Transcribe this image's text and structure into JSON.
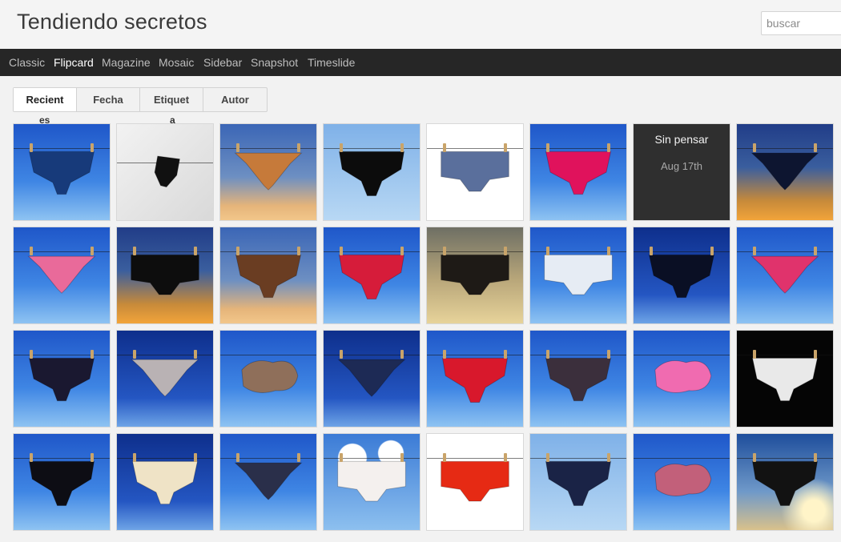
{
  "site": {
    "title": "Tendiendo secretos"
  },
  "search": {
    "placeholder": "buscar"
  },
  "nav": {
    "items": [
      {
        "label": "Classic",
        "active": false
      },
      {
        "label": "Flipcard",
        "active": true
      },
      {
        "label": "Magazine",
        "active": false
      },
      {
        "label": "Mosaic",
        "active": false
      },
      {
        "label": "Sidebar",
        "active": false
      },
      {
        "label": "Snapshot",
        "active": false
      },
      {
        "label": "Timeslide",
        "active": false
      }
    ]
  },
  "tabs": {
    "items": [
      {
        "label": "Recient",
        "active": true
      },
      {
        "label": "Fecha",
        "active": false
      },
      {
        "label": "Etiquet",
        "active": false
      },
      {
        "label": "Autor",
        "active": false
      }
    ],
    "overflow": [
      "es",
      "a"
    ]
  },
  "grid": {
    "cards": [
      {
        "type": "photo",
        "sky": "sky-blue",
        "color": "#173a7a",
        "shape": "brief"
      },
      {
        "type": "photo",
        "sky": "sky-gray",
        "color": "#111111",
        "shape": "shadow"
      },
      {
        "type": "photo",
        "sky": "sky-dusk",
        "color": "#c67a3a",
        "shape": "thong"
      },
      {
        "type": "photo",
        "sky": "sky-pale",
        "color": "#0c0c0c",
        "shape": "lace"
      },
      {
        "type": "photo",
        "sky": "sky-white",
        "color": "#5a6f9c",
        "shape": "hipster"
      },
      {
        "type": "photo",
        "sky": "sky-blue",
        "color": "#e0125c",
        "shape": "brief"
      },
      {
        "type": "text",
        "title": "Sin pensar",
        "date": "Aug 17th"
      },
      {
        "type": "photo",
        "sky": "sky-sunset",
        "color": "#0d1530",
        "shape": "thong"
      },
      {
        "type": "photo",
        "sky": "sky-blue",
        "color": "#e96a9a",
        "shape": "thong"
      },
      {
        "type": "photo",
        "sky": "sky-sunset",
        "color": "#0d0d0d",
        "shape": "hipster"
      },
      {
        "type": "photo",
        "sky": "sky-dusk",
        "color": "#6a3d22",
        "shape": "brief"
      },
      {
        "type": "photo",
        "sky": "sky-blue",
        "color": "#d61c3a",
        "shape": "lace"
      },
      {
        "type": "photo",
        "sky": "sky-gold",
        "color": "#1e1a16",
        "shape": "hipster"
      },
      {
        "type": "photo",
        "sky": "sky-blue",
        "color": "#e6ecf4",
        "shape": "hipster"
      },
      {
        "type": "photo",
        "sky": "sky-deep",
        "color": "#0a0f24",
        "shape": "brief"
      },
      {
        "type": "photo",
        "sky": "sky-blue",
        "color": "#e0336c",
        "shape": "thong"
      },
      {
        "type": "photo",
        "sky": "sky-blue",
        "color": "#1a1830",
        "shape": "brief"
      },
      {
        "type": "photo",
        "sky": "sky-deep",
        "color": "#b9b2b4",
        "shape": "thong"
      },
      {
        "type": "photo",
        "sky": "sky-blue",
        "color": "#8f6f5a",
        "shape": "bundle"
      },
      {
        "type": "photo",
        "sky": "sky-deep",
        "color": "#1d2a55",
        "shape": "thong"
      },
      {
        "type": "photo",
        "sky": "sky-blue",
        "color": "#d8182c",
        "shape": "lace"
      },
      {
        "type": "photo",
        "sky": "sky-blue",
        "color": "#3b2f3c",
        "shape": "brief"
      },
      {
        "type": "photo",
        "sky": "sky-blue",
        "color": "#f06bb0",
        "shape": "bundle"
      },
      {
        "type": "photo",
        "sky": "sky-night",
        "color": "#e9e9e9",
        "shape": "brief"
      },
      {
        "type": "photo",
        "sky": "sky-blue",
        "color": "#0d0d14",
        "shape": "lace"
      },
      {
        "type": "photo",
        "sky": "sky-deep",
        "color": "#efe3c6",
        "shape": "brief"
      },
      {
        "type": "photo",
        "sky": "sky-blue",
        "color": "#2a2f4a",
        "shape": "thong"
      },
      {
        "type": "photo",
        "sky": "sky-cloud",
        "color": "#f4f0ee",
        "shape": "hipster"
      },
      {
        "type": "photo",
        "sky": "sky-white",
        "color": "#e62a14",
        "shape": "hipster"
      },
      {
        "type": "photo",
        "sky": "sky-pale",
        "color": "#1a2346",
        "shape": "lace"
      },
      {
        "type": "photo",
        "sky": "sky-blue",
        "color": "#c2607a",
        "shape": "bundle"
      },
      {
        "type": "photo",
        "sky": "sky-sun",
        "color": "#121212",
        "shape": "lace"
      }
    ]
  }
}
